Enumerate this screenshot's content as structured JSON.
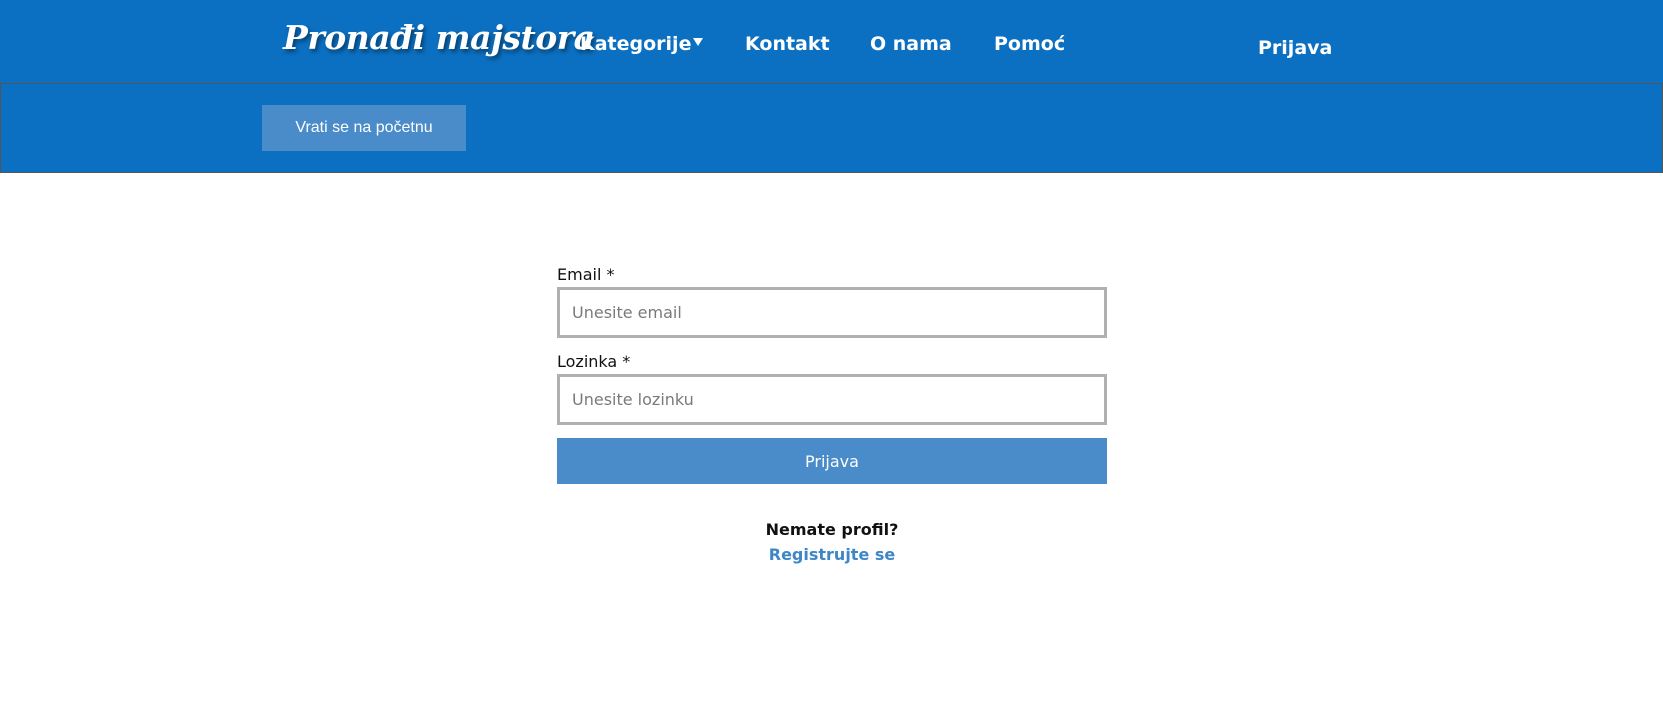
{
  "header": {
    "logo": "Pronađi majstora",
    "nav": {
      "categories": "Kategorije",
      "contact": "Kontakt",
      "about": "O nama",
      "help": "Pomoć"
    },
    "login": "Prijava"
  },
  "subbar": {
    "back_button": "Vrati se na početnu"
  },
  "form": {
    "email_label": "Email *",
    "email_placeholder": "Unesite email",
    "password_label": "Lozinka *",
    "password_placeholder": "Unesite lozinku",
    "submit": "Prijava",
    "no_profile": "Nemate profil?",
    "register": "Registrujte se"
  },
  "colors": {
    "brand": "#0c70c2",
    "button": "#4a8bc9",
    "link": "#3f86c6"
  }
}
